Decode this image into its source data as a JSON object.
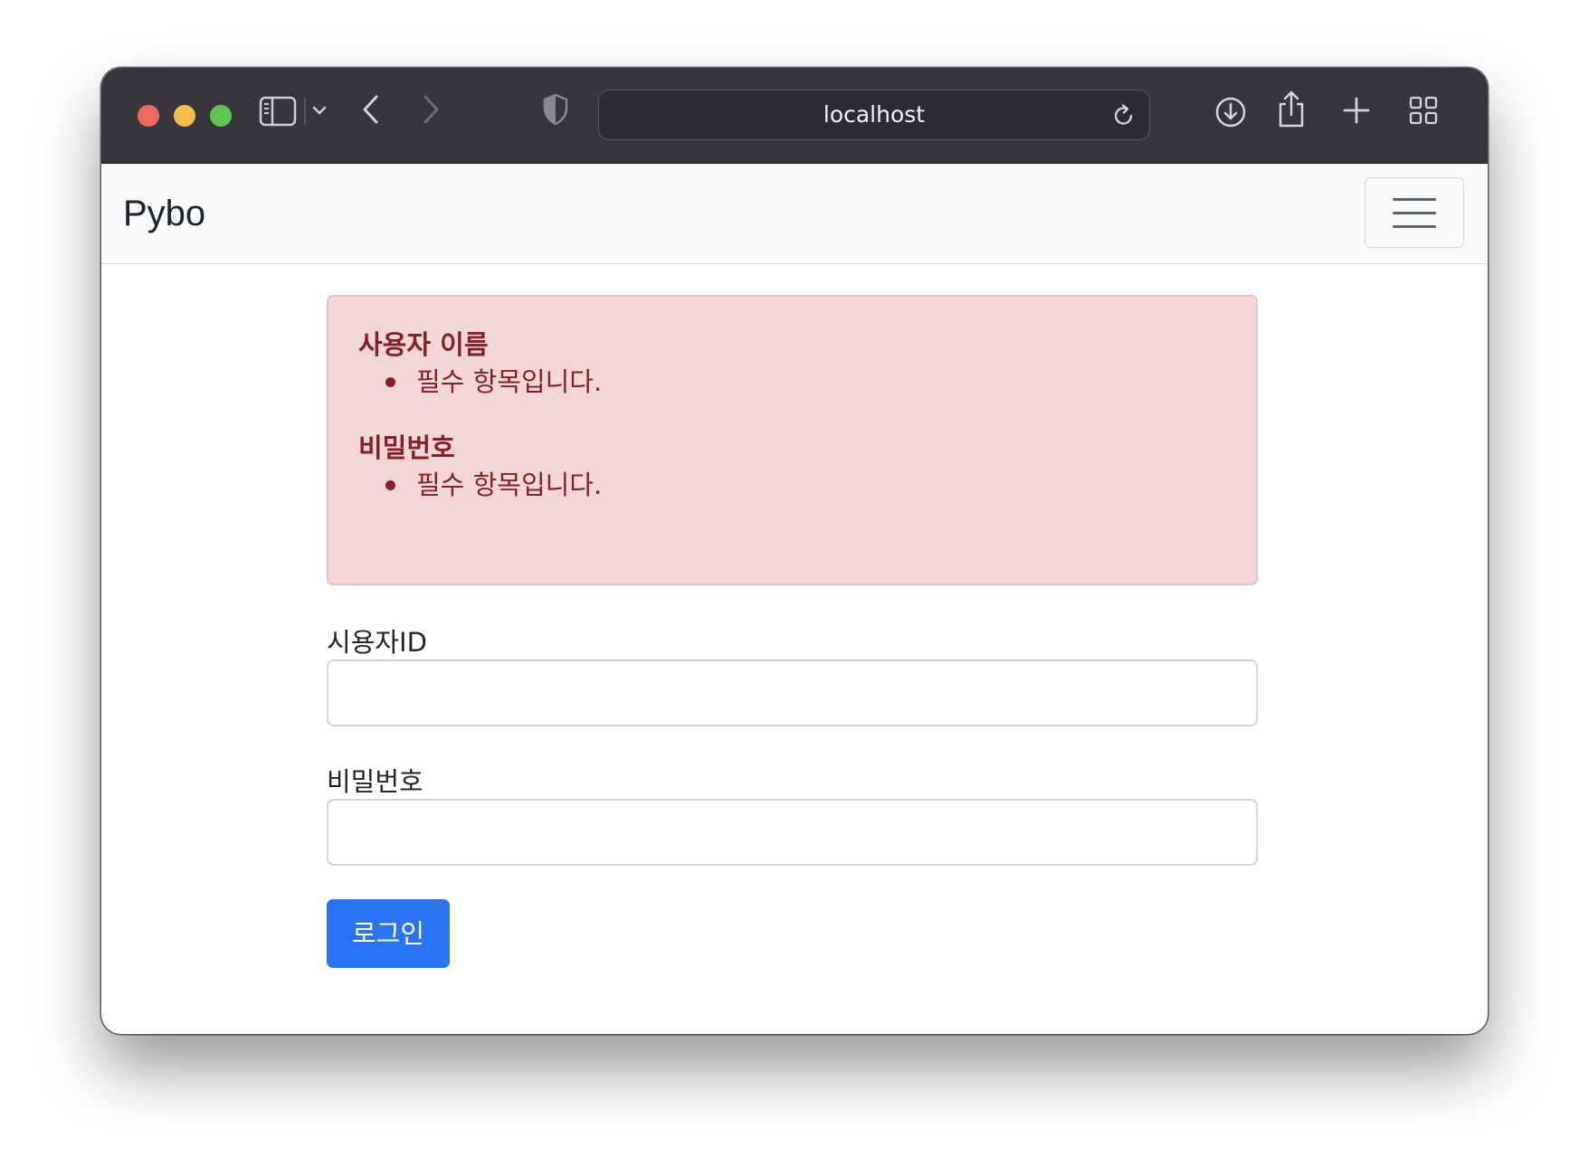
{
  "browser": {
    "url": "localhost"
  },
  "navbar": {
    "brand": "Pybo"
  },
  "errors": [
    {
      "field": "사용자 이름",
      "messages": [
        "필수 항목입니다."
      ]
    },
    {
      "field": "비밀번호",
      "messages": [
        "필수 항목입니다."
      ]
    }
  ],
  "form": {
    "username_label": "시용자ID",
    "username_value": "",
    "password_label": "비밀번호",
    "password_value": "",
    "submit_label": "로그인"
  },
  "colors": {
    "toolbar": "#37353b",
    "alert_background": "#f3d6d8",
    "alert_text": "#842029",
    "primary_button": "#2a73f5"
  }
}
